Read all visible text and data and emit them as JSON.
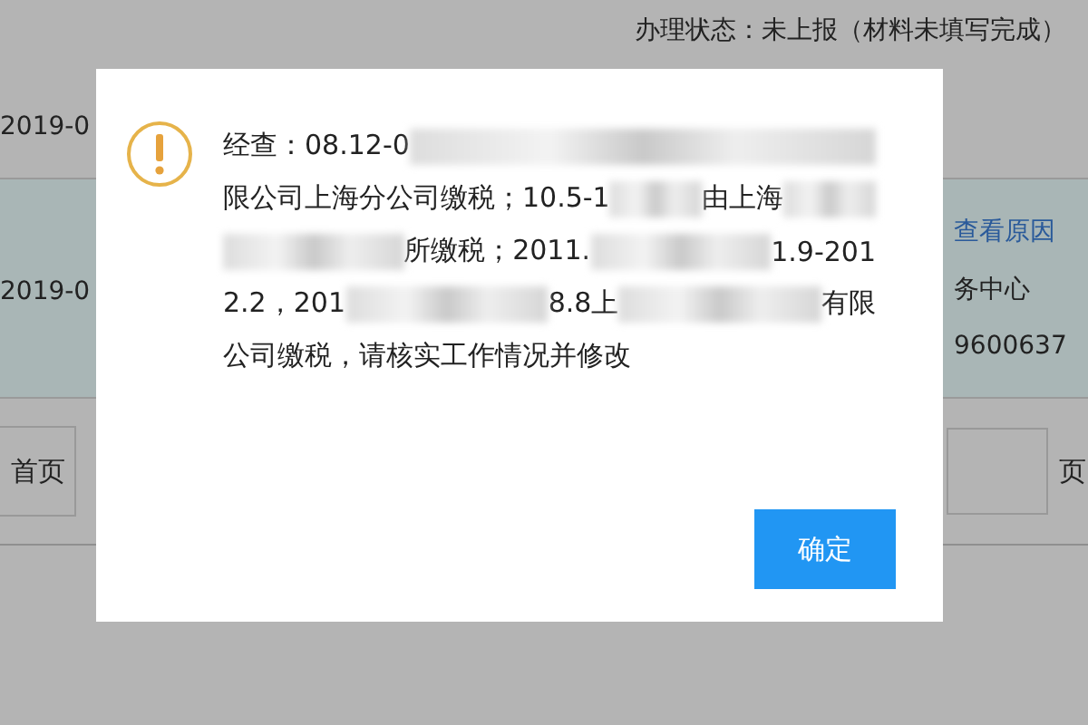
{
  "page": {
    "status": "办理状态：未上报（材料未填写完成）",
    "rows": [
      {
        "left": [
          "2019-0"
        ],
        "right": [],
        "highlighted": false
      },
      {
        "left": [
          "2019-0"
        ],
        "right": [
          {
            "text": "查看原因",
            "kind": "link"
          },
          {
            "text": "务中心",
            "kind": "text"
          },
          {
            "text": "9600637",
            "kind": "text"
          }
        ],
        "highlighted": true
      }
    ],
    "pager": {
      "first": "首页",
      "page_label": "页"
    }
  },
  "dialog": {
    "lines": [
      [
        {
          "text": "经查：08.12-0"
        },
        {
          "kind": "redacted"
        }
      ],
      [
        {
          "text": "限公司上海分公司缴税；10.5-1"
        },
        {
          "kind": "redacted"
        },
        {
          "text": "由上海"
        },
        {
          "kind": "redacted"
        }
      ],
      [
        {
          "kind": "redacted"
        },
        {
          "text": "所缴税；2011."
        },
        {
          "kind": "redacted"
        },
        {
          "text": "1.9-201"
        }
      ],
      [
        {
          "text": "2.2，201"
        },
        {
          "kind": "redacted"
        },
        {
          "text": "8.8上"
        },
        {
          "kind": "redacted"
        },
        {
          "text": "有限"
        }
      ],
      [
        {
          "text": "公司缴税，请核实工作情况并修改"
        }
      ]
    ],
    "button": "确定"
  }
}
